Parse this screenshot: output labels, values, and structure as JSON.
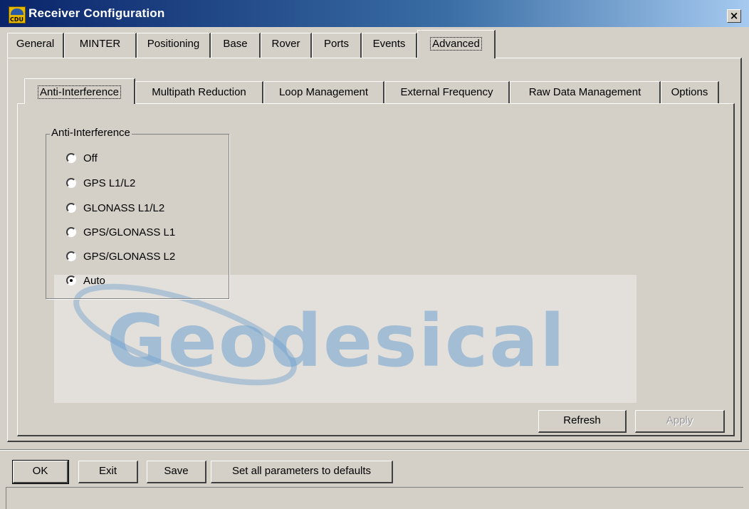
{
  "window": {
    "title": "Receiver Configuration",
    "close_label": "×",
    "icon_text": "CDU"
  },
  "top_tabs": [
    {
      "label": "General",
      "selected": false
    },
    {
      "label": "MINTER",
      "selected": false
    },
    {
      "label": "Positioning",
      "selected": false
    },
    {
      "label": "Base",
      "selected": false
    },
    {
      "label": "Rover",
      "selected": false
    },
    {
      "label": "Ports",
      "selected": false
    },
    {
      "label": "Events",
      "selected": false
    },
    {
      "label": "Advanced",
      "selected": true
    }
  ],
  "sub_tabs": [
    {
      "label": "Anti-Interference",
      "selected": true
    },
    {
      "label": "Multipath Reduction",
      "selected": false
    },
    {
      "label": "Loop Management",
      "selected": false
    },
    {
      "label": "External Frequency",
      "selected": false
    },
    {
      "label": "Raw Data Management",
      "selected": false
    },
    {
      "label": "Options",
      "selected": false
    }
  ],
  "anti_interference": {
    "group_title": "Anti-Interference",
    "options": [
      {
        "label": "Off",
        "checked": false
      },
      {
        "label": "GPS L1/L2",
        "checked": false
      },
      {
        "label": "GLONASS L1/L2",
        "checked": false
      },
      {
        "label": "GPS/GLONASS L1",
        "checked": false
      },
      {
        "label": "GPS/GLONASS L2",
        "checked": false
      },
      {
        "label": "Auto",
        "checked": true
      }
    ]
  },
  "watermark": {
    "text": "Geodesical"
  },
  "panel_buttons": {
    "refresh": "Refresh",
    "apply": "Apply"
  },
  "footer_buttons": {
    "ok": "OK",
    "exit": "Exit",
    "save": "Save",
    "defaults": "Set all parameters to defaults"
  },
  "colors": {
    "face": "#d4d0c8",
    "title_start": "#0a246a",
    "title_end": "#a6caf0"
  }
}
